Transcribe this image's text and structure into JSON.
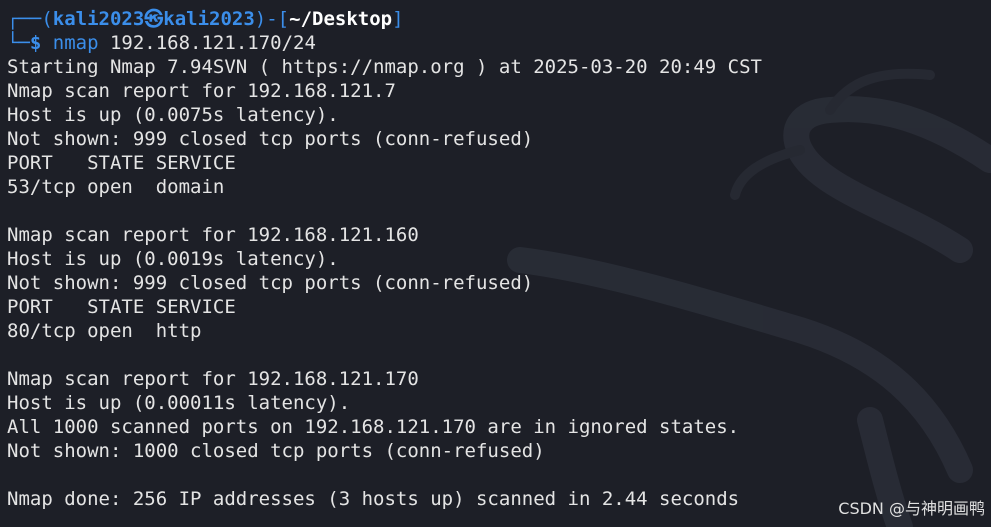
{
  "prompt": {
    "frame_top": "┌──(",
    "user_host": "kali2023㉿kali2023",
    "sep": ")-[",
    "dir": "~/Desktop",
    "close": "]",
    "frame_bottom": "└─",
    "dollar": "$ ",
    "command": "nmap",
    "argument": " 192.168.121.170/24"
  },
  "output_lines": [
    "Starting Nmap 7.94SVN ( https://nmap.org ) at 2025-03-20 20:49 CST",
    "Nmap scan report for 192.168.121.7",
    "Host is up (0.0075s latency).",
    "Not shown: 999 closed tcp ports (conn-refused)",
    "PORT   STATE SERVICE",
    "53/tcp open  domain",
    "",
    "Nmap scan report for 192.168.121.160",
    "Host is up (0.0019s latency).",
    "Not shown: 999 closed tcp ports (conn-refused)",
    "PORT   STATE SERVICE",
    "80/tcp open  http",
    "",
    "Nmap scan report for 192.168.121.170",
    "Host is up (0.00011s latency).",
    "All 1000 scanned ports on 192.168.121.170 are in ignored states.",
    "Not shown: 1000 closed tcp ports (conn-refused)",
    "",
    "Nmap done: 256 IP addresses (3 hosts up) scanned in 2.44 seconds"
  ],
  "watermark": "CSDN @与神明画鸭",
  "colors": {
    "background": "#1d1f27",
    "prompt_blue": "#3b8eea",
    "text": "#e4e4e4"
  },
  "icons": {
    "background_art": "kali-dragon-icon"
  }
}
